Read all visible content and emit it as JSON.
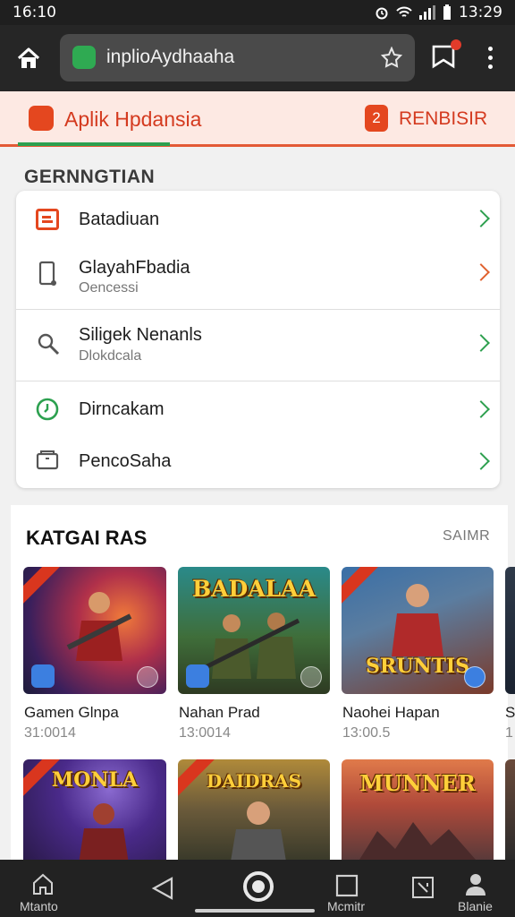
{
  "status_bar": {
    "time_left": "16:10",
    "time_right": "13:29"
  },
  "browser": {
    "url": "inplioAydhaaha"
  },
  "app_header": {
    "title": "Aplik Hpdansia",
    "register_badge": "2",
    "register_label": "RENBISIR"
  },
  "settings": {
    "title": "GERNNGTIAN",
    "items": [
      {
        "title": "Batadiuan",
        "subtitle": "",
        "icon": "image-icon"
      },
      {
        "title": "GlayahFbadia",
        "subtitle": "Oencessi",
        "icon": "phone-icon"
      },
      {
        "title": "Siligek Nenanls",
        "subtitle": "Dlokdcala",
        "icon": "search-icon"
      },
      {
        "title": "Dirncakam",
        "subtitle": "",
        "icon": "clock-icon"
      },
      {
        "title": "PencoSaha",
        "subtitle": "",
        "icon": "box-icon"
      }
    ]
  },
  "categories": {
    "title": "KATGAI RAS",
    "more_label": "SAIMR",
    "row1": [
      {
        "name": "Gamen Glnpa",
        "meta": "31:0014",
        "logo": ""
      },
      {
        "name": "Nahan Prad",
        "meta": "13:0014",
        "logo": "BADALAA"
      },
      {
        "name": "Naohei Hapan",
        "meta": "13:00.5",
        "logo": "SRUNTIS"
      },
      {
        "name": "S",
        "meta": "1",
        "logo": ""
      }
    ],
    "row2": [
      {
        "logo": "MONLA"
      },
      {
        "logo": "DAIDRAS"
      },
      {
        "logo": "MUNNER"
      }
    ]
  },
  "bottom_nav": {
    "home_label": "Mtanto",
    "tasks_label": "Mcmitr",
    "profile_label": "Blanie"
  },
  "colors": {
    "accent": "#e4471f",
    "green": "#2ca04f",
    "header_bg": "#fde9e3"
  }
}
